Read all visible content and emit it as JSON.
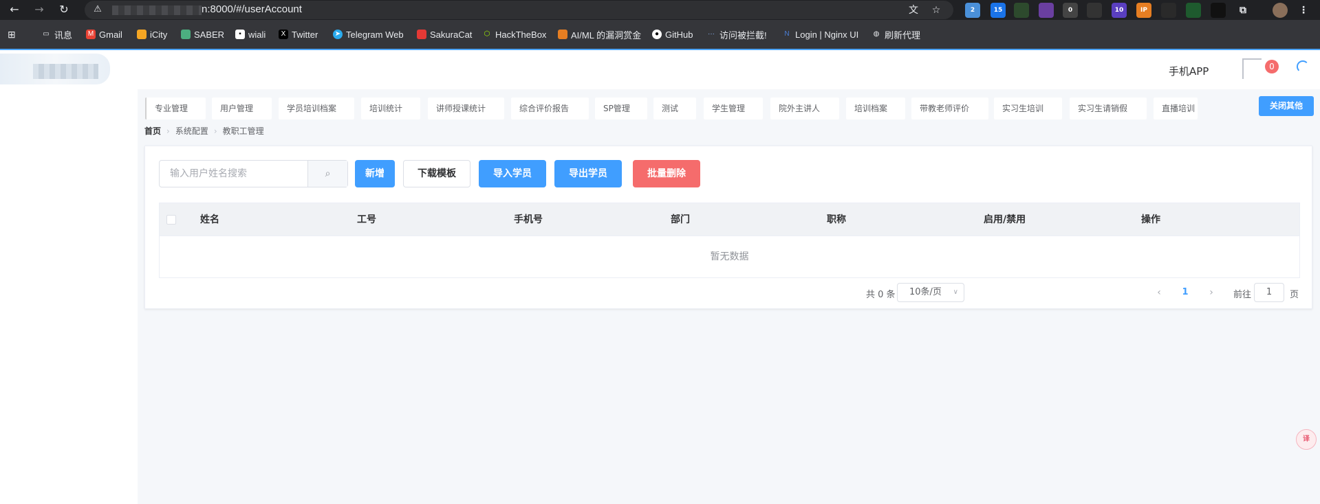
{
  "browser": {
    "url_suffix": "n:8000/#/userAccount",
    "bookmarks": [
      {
        "label": "讯息",
        "icon": "folder-icon"
      },
      {
        "label": "Gmail",
        "icon": "gmail-icon"
      },
      {
        "label": "iCity",
        "icon": "icity-icon"
      },
      {
        "label": "SABER",
        "icon": "saber-icon"
      },
      {
        "label": "wiali",
        "icon": "wiali-icon"
      },
      {
        "label": "Twitter",
        "icon": "x-icon"
      },
      {
        "label": "Telegram Web",
        "icon": "telegram-icon"
      },
      {
        "label": "SakuraCat",
        "icon": "sakuracat-icon"
      },
      {
        "label": "HackTheBox",
        "icon": "hackthebox-icon"
      },
      {
        "label": "AI/ML 的漏洞赏金",
        "icon": "huntr-icon"
      },
      {
        "label": "GitHub",
        "icon": "github-icon"
      },
      {
        "label": "访问被拦截!",
        "icon": "dots-icon"
      },
      {
        "label": "Login | Nginx UI",
        "icon": "nginx-icon"
      },
      {
        "label": "刷新代理",
        "icon": "globe-icon"
      }
    ],
    "ext_badges": [
      "2",
      "15",
      "0",
      "10"
    ]
  },
  "header": {
    "app_link": "手机APP",
    "notification_count": "0"
  },
  "tabs": [
    "专业管理",
    "用户管理",
    "学员培训档案",
    "培训统计",
    "讲师授课统计",
    "综合评价报告",
    "SP管理",
    "测试",
    "学生管理",
    "院外主讲人",
    "培训档案",
    "带教老师评价",
    "实习生培训",
    "实习生请销假",
    "直播培训"
  ],
  "close_others_label": "关闭其他",
  "breadcrumb": [
    "首页",
    "系统配置",
    "教职工管理"
  ],
  "toolbar": {
    "search_placeholder": "输入用户姓名搜索",
    "add_label": "新增",
    "download_template_label": "下载模板",
    "import_label": "导入学员",
    "export_label": "导出学员",
    "batch_delete_label": "批量删除"
  },
  "table": {
    "columns": [
      "姓名",
      "工号",
      "手机号",
      "部门",
      "职称",
      "启用/禁用",
      "操作"
    ],
    "empty_text": "暂无数据"
  },
  "pagination": {
    "total_text": "共 0 条",
    "page_size": "10条/页",
    "current_page": "1",
    "goto_prefix": "前往",
    "goto_value": "1",
    "goto_suffix": "页"
  },
  "colors": {
    "primary": "#409eff",
    "danger": "#f56c6c",
    "accent_line": "#4aa3f7"
  }
}
